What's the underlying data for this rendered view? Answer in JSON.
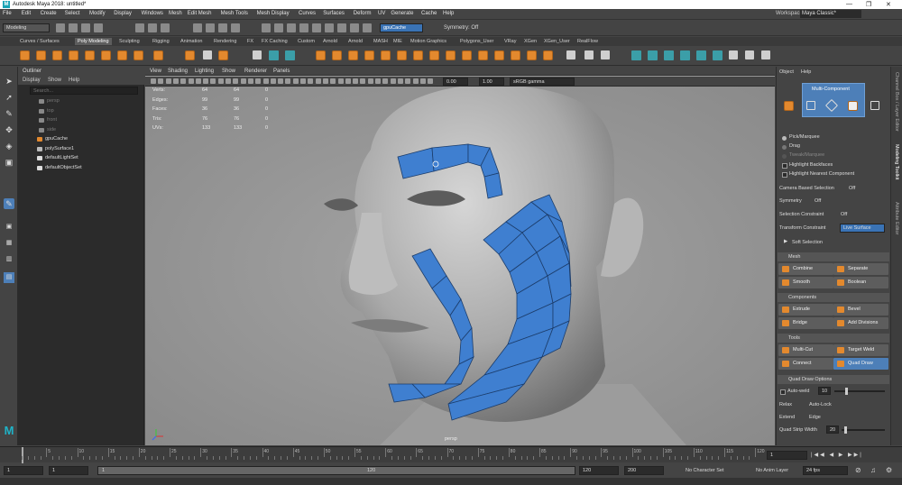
{
  "window": {
    "title": "Autodesk Maya 2018: untitled*",
    "app_icon": "M"
  },
  "menubar": [
    "File",
    "Edit",
    "Create",
    "Select",
    "Modify",
    "Display",
    "Windows",
    "Mesh",
    "Edit Mesh",
    "Mesh Tools",
    "Mesh Display",
    "Curves",
    "Surfaces",
    "Deform",
    "UV",
    "Generate",
    "Cache",
    "Help"
  ],
  "workspace": {
    "label": "Workspace :",
    "value": "Maya Classic*"
  },
  "statusline": {
    "menuset": "Modeling",
    "object_name": "gpuCache",
    "symmetry": "Symmetry: Off"
  },
  "shelf_tabs": [
    "Curves / Surfaces",
    "Poly Modeling",
    "Sculpting",
    "Rigging",
    "Animation",
    "Rendering",
    "FX",
    "FX Caching",
    "Custom",
    "Arnold",
    "Arnold",
    "MASH",
    "MIE",
    "Motion Graphics",
    "Polygons_User",
    "VRay",
    "XGen",
    "XGen_User",
    "RealFlow"
  ],
  "shelf_active": "Poly Modeling",
  "outliner": {
    "title": "Outliner",
    "menu": [
      "Display",
      "Show",
      "Help"
    ],
    "search_placeholder": "Search...",
    "items": [
      "persp",
      "top",
      "front",
      "side",
      "gpuCache",
      "polySurface1",
      "defaultLightSet",
      "defaultObjectSet"
    ]
  },
  "viewport": {
    "menu": [
      "View",
      "Shading",
      "Lighting",
      "Show",
      "Renderer",
      "Panels"
    ],
    "exposure": "0.00",
    "gamma": "1.00",
    "colorspace": "sRGB gamma",
    "camera_label": "persp",
    "hud": [
      {
        "label": "Verts:",
        "a": "64",
        "b": "64",
        "c": "0"
      },
      {
        "label": "Edges:",
        "a": "99",
        "b": "99",
        "c": "0"
      },
      {
        "label": "Faces:",
        "a": "36",
        "b": "36",
        "c": "0"
      },
      {
        "label": "Tris:",
        "a": "76",
        "b": "76",
        "c": "0"
      },
      {
        "label": "UVs:",
        "a": "133",
        "b": "133",
        "c": "0"
      }
    ]
  },
  "modeling_toolkit": {
    "menu": [
      "Object",
      "Help"
    ],
    "mode_label": "Multi-Component",
    "selection": {
      "pick_marquee": "Pick/Marquee",
      "drag": "Drag",
      "tweak": "Tweak/Marquee",
      "highlight_backfaces": "Highlight Backfaces",
      "highlight_nearest": "Highlight Nearest Component",
      "camera_based": "Camera Based Selection",
      "camera_based_value": "Off",
      "symmetry": "Symmetry",
      "symmetry_value": "Off",
      "selection_constraint": "Selection Constraint",
      "selection_constraint_value": "Off",
      "transform_constraint": "Transform Constraint",
      "transform_constraint_value": "Live Surface",
      "soft_selection": "Soft Selection"
    },
    "sections": {
      "mesh": "Mesh",
      "components": "Components",
      "tools": "Tools",
      "quad_draw_options": "Quad Draw Options"
    },
    "mesh_buttons": [
      "Combine",
      "Separate",
      "Smooth",
      "Boolean"
    ],
    "component_buttons": [
      "Extrude",
      "Bevel",
      "Bridge",
      "Add Divisions"
    ],
    "tool_buttons": [
      "Multi-Cut",
      "Target Weld",
      "Connect",
      "Quad Draw"
    ],
    "active_tool": "Quad Draw",
    "quad_draw": {
      "auto_weld": "Auto-weld",
      "auto_weld_value": "10",
      "relax": "Relax",
      "relax_value": "Auto-Lock",
      "extend": "Extend",
      "extend_value": "Edge",
      "quad_strip_width": "Quad Strip Width",
      "quad_strip_value": "20"
    }
  },
  "right_tabs": [
    "Channel Box / Layer Editor",
    "Modeling Toolkit",
    "Attribute Editor"
  ],
  "timeline": {
    "ticks": [
      "5",
      "10",
      "15",
      "20",
      "25",
      "30",
      "35",
      "40",
      "45",
      "50",
      "55",
      "60",
      "65",
      "70",
      "75",
      "80",
      "85",
      "90",
      "95",
      "100",
      "105",
      "110",
      "115",
      "120"
    ],
    "current_frame": "1"
  },
  "range": {
    "start": "1",
    "playback_start": "1",
    "inner_start": "1",
    "inner_end": "120",
    "playback_end": "120",
    "end": "200",
    "character_set": "No Character Set",
    "anim_layer": "No Anim Layer",
    "fps": "24 fps"
  },
  "colors": {
    "accent": "#4d7fb8",
    "icon_orange": "#e3892e",
    "selected_face": "#3f7fd0",
    "teal": "#3b9ea8"
  }
}
